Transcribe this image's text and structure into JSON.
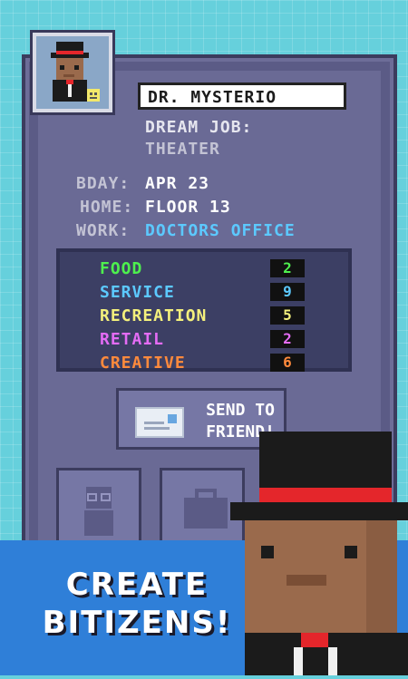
{
  "profile": {
    "name": "DR. MYSTERIO",
    "dream_job_label": "DREAM JOB:",
    "dream_job": "THEATER",
    "bday_label": "BDAY:",
    "bday": "APR 23",
    "home_label": "HOME:",
    "home": "FLOOR 13",
    "work_label": "WORK:",
    "work": "DOCTORS OFFICE"
  },
  "stats": [
    {
      "label": "FOOD",
      "value": "2",
      "color": "#4ef04e"
    },
    {
      "label": "SERVICE",
      "value": "9",
      "color": "#5cc9ff"
    },
    {
      "label": "RECREATION",
      "value": "5",
      "color": "#f4f07c"
    },
    {
      "label": "RETAIL",
      "value": "2",
      "color": "#e46cf5"
    },
    {
      "label": "CREATIVE",
      "value": "6",
      "color": "#ff8a3c"
    }
  ],
  "send_button": {
    "label_line1": "SEND TO",
    "label_line2": "FRIEND!"
  },
  "banner": {
    "line1": "CREATE",
    "line2": "BITIZENS!"
  },
  "colors": {
    "background": "#66d0dc",
    "card": "#5b5b86",
    "banner": "#2f7fd8",
    "work_link": "#5cc9ff"
  }
}
